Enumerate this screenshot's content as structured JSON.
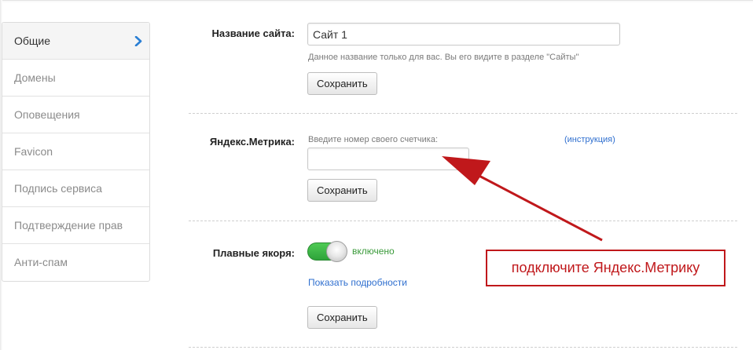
{
  "sidebar": {
    "items": [
      {
        "label": "Общие",
        "active": true
      },
      {
        "label": "Домены"
      },
      {
        "label": "Оповещения"
      },
      {
        "label": "Favicon"
      },
      {
        "label": "Подпись сервиса"
      },
      {
        "label": "Подтверждение прав"
      },
      {
        "label": "Анти-спам"
      }
    ],
    "active_icon": "chevron-right-icon"
  },
  "site_name": {
    "label": "Название сайта:",
    "value": "Сайт 1",
    "hint": "Данное название только для вас. Вы его видите в разделе \"Сайты\"",
    "save_label": "Сохранить"
  },
  "metrika": {
    "label": "Яндекс.Метрика:",
    "hint": "Введите номер своего счетчика:",
    "instruction_link": "(инструкция)",
    "value": "",
    "save_label": "Сохранить"
  },
  "anchors": {
    "label": "Плавные якоря:",
    "toggle_state": "включено",
    "toggle_on": true,
    "details_link": "Показать подробности",
    "save_label": "Сохранить"
  },
  "annotation": {
    "text": "подключите Яндекс.Метрику"
  },
  "colors": {
    "accent_link": "#2f6fcf",
    "toggle_on": "#3fba47",
    "annotation_red": "#c0181b",
    "chevron": "#2a7fd4"
  }
}
